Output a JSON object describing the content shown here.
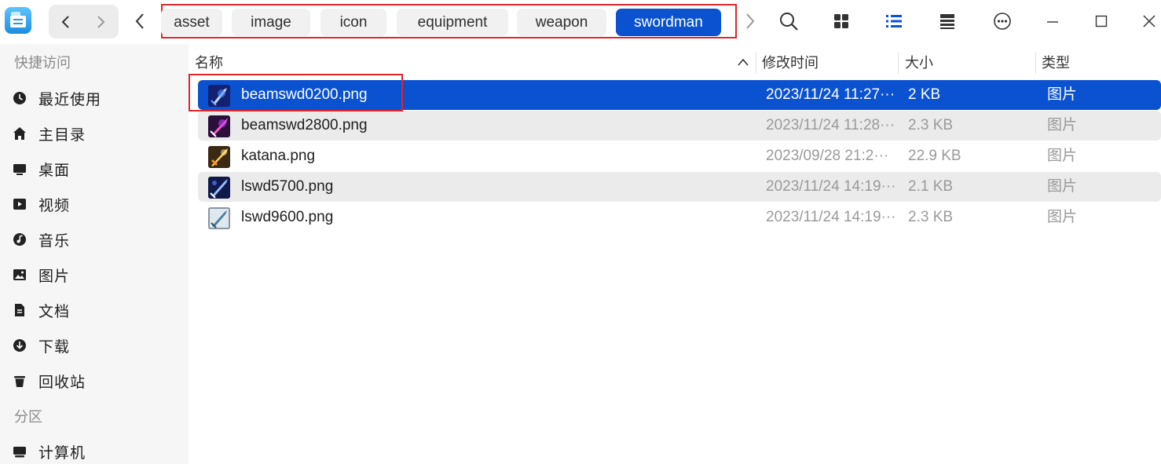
{
  "toolbar": {
    "breadcrumbs": [
      {
        "label": "asset",
        "active": false
      },
      {
        "label": "image",
        "active": false
      },
      {
        "label": "icon",
        "active": false
      },
      {
        "label": "equipment",
        "active": false
      },
      {
        "label": "weapon",
        "active": false
      },
      {
        "label": "swordman",
        "active": true
      }
    ],
    "icons": [
      "back-icon",
      "forward-icon",
      "chevron-left-icon",
      "chevron-right-icon",
      "search-icon",
      "grid-view-icon",
      "list-view-icon",
      "detail-view-icon",
      "more-icon",
      "minimize-icon",
      "maximize-icon",
      "close-icon"
    ]
  },
  "sidebar": {
    "section_quick": "快捷访问",
    "quick_items": [
      {
        "label": "最近使用",
        "icon": "clock-icon"
      },
      {
        "label": "主目录",
        "icon": "home-icon"
      },
      {
        "label": "桌面",
        "icon": "desktop-icon"
      },
      {
        "label": "视频",
        "icon": "video-icon"
      },
      {
        "label": "音乐",
        "icon": "music-icon"
      },
      {
        "label": "图片",
        "icon": "picture-icon"
      },
      {
        "label": "文档",
        "icon": "document-icon"
      },
      {
        "label": "下载",
        "icon": "download-icon"
      },
      {
        "label": "回收站",
        "icon": "trash-icon"
      }
    ],
    "section_partition": "分区",
    "partition_items": [
      {
        "label": "计算机",
        "icon": "computer-icon"
      }
    ]
  },
  "list": {
    "columns": {
      "name": "名称",
      "modified": "修改时间",
      "size": "大小",
      "type": "类型"
    },
    "sort": {
      "column": "name",
      "direction": "ascending"
    },
    "rows": [
      {
        "name": "beamswd0200.png",
        "modified": "2023/11/24 11:27···",
        "size": "2 KB",
        "type": "图片",
        "selected": true
      },
      {
        "name": "beamswd2800.png",
        "modified": "2023/11/24 11:28···",
        "size": "2.3 KB",
        "type": "图片",
        "selected": false
      },
      {
        "name": "katana.png",
        "modified": "2023/09/28 21:2···",
        "size": "22.9 KB",
        "type": "图片",
        "selected": false
      },
      {
        "name": "lswd5700.png",
        "modified": "2023/11/24 14:19···",
        "size": "2.1 KB",
        "type": "图片",
        "selected": false
      },
      {
        "name": "lswd9600.png",
        "modified": "2023/11/24 14:19···",
        "size": "2.3 KB",
        "type": "图片",
        "selected": false
      }
    ]
  },
  "colors": {
    "accent": "#0b52d1",
    "highlight_box": "#e0262b",
    "alt_row": "#ebebeb",
    "sidebar_bg": "#f6f6f6"
  }
}
